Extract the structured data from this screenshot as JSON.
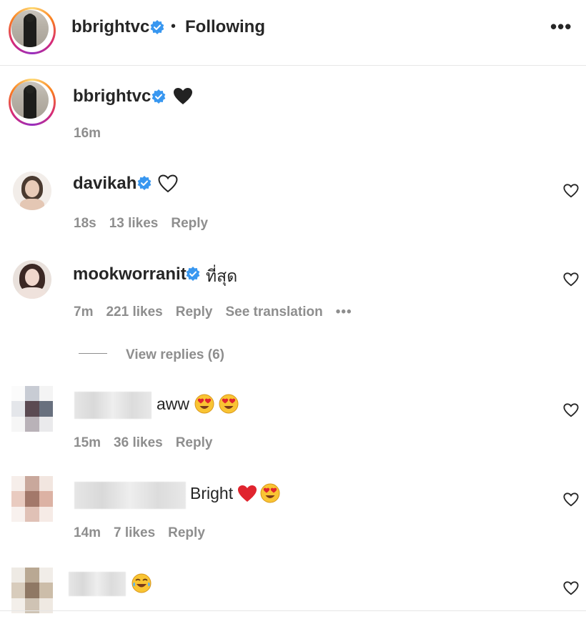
{
  "post": {
    "author": "bbrightvc",
    "separator": "•",
    "follow_status": "Following",
    "more_label": "•••",
    "caption_author": "bbrightvc",
    "caption_emoji": "black-heart",
    "caption_time": "16m"
  },
  "comments": [
    {
      "username": "davikah",
      "verified": true,
      "text": "",
      "emoji": "white-heart-outline",
      "time": "18s",
      "likes": "13 likes",
      "reply": "Reply"
    },
    {
      "username": "mookworranit",
      "verified": true,
      "text": "ที่สุด",
      "time": "7m",
      "likes": "221 likes",
      "reply": "Reply",
      "translation": "See translation",
      "more": "•••",
      "view_replies": "View replies (6)"
    },
    {
      "username": "",
      "text": "aww",
      "emoji": "heart-eyes x2",
      "time": "15m",
      "likes": "36 likes",
      "reply": "Reply"
    },
    {
      "username": "",
      "text": "Bright",
      "emoji": "red-heart, heart-eyes",
      "time": "14m",
      "likes": "7 likes",
      "reply": "Reply"
    },
    {
      "username": "",
      "text": "",
      "emoji": "tears-of-joy"
    }
  ],
  "colors": {
    "verified": "#3897f0",
    "meta": "#8e8e8e",
    "text": "#262626",
    "divider": "#e6e6e6"
  }
}
